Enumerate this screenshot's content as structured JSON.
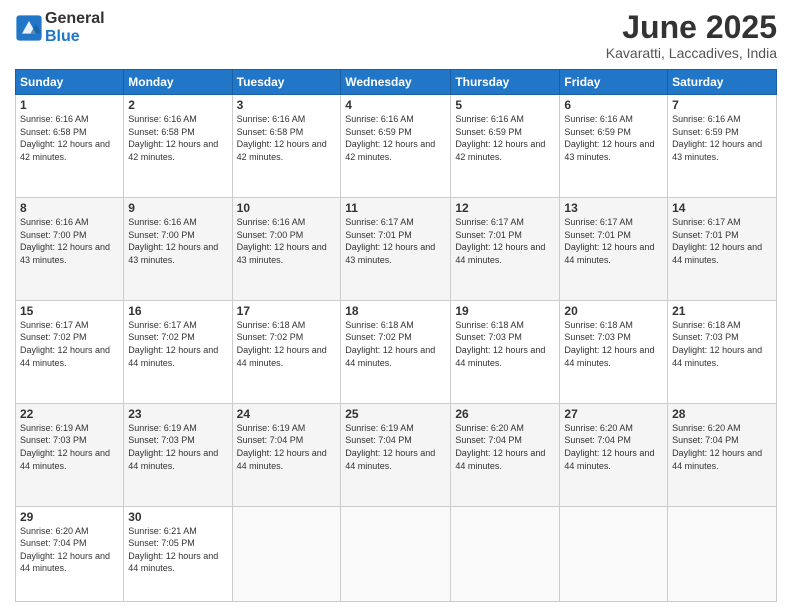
{
  "logo": {
    "general": "General",
    "blue": "Blue"
  },
  "title": "June 2025",
  "location": "Kavaratti, Laccadives, India",
  "days_header": [
    "Sunday",
    "Monday",
    "Tuesday",
    "Wednesday",
    "Thursday",
    "Friday",
    "Saturday"
  ],
  "weeks": [
    [
      {
        "num": "1",
        "sunrise": "6:16 AM",
        "sunset": "6:58 PM",
        "daylight": "12 hours and 42 minutes."
      },
      {
        "num": "2",
        "sunrise": "6:16 AM",
        "sunset": "6:58 PM",
        "daylight": "12 hours and 42 minutes."
      },
      {
        "num": "3",
        "sunrise": "6:16 AM",
        "sunset": "6:58 PM",
        "daylight": "12 hours and 42 minutes."
      },
      {
        "num": "4",
        "sunrise": "6:16 AM",
        "sunset": "6:59 PM",
        "daylight": "12 hours and 42 minutes."
      },
      {
        "num": "5",
        "sunrise": "6:16 AM",
        "sunset": "6:59 PM",
        "daylight": "12 hours and 42 minutes."
      },
      {
        "num": "6",
        "sunrise": "6:16 AM",
        "sunset": "6:59 PM",
        "daylight": "12 hours and 43 minutes."
      },
      {
        "num": "7",
        "sunrise": "6:16 AM",
        "sunset": "6:59 PM",
        "daylight": "12 hours and 43 minutes."
      }
    ],
    [
      {
        "num": "8",
        "sunrise": "6:16 AM",
        "sunset": "7:00 PM",
        "daylight": "12 hours and 43 minutes."
      },
      {
        "num": "9",
        "sunrise": "6:16 AM",
        "sunset": "7:00 PM",
        "daylight": "12 hours and 43 minutes."
      },
      {
        "num": "10",
        "sunrise": "6:16 AM",
        "sunset": "7:00 PM",
        "daylight": "12 hours and 43 minutes."
      },
      {
        "num": "11",
        "sunrise": "6:17 AM",
        "sunset": "7:01 PM",
        "daylight": "12 hours and 43 minutes."
      },
      {
        "num": "12",
        "sunrise": "6:17 AM",
        "sunset": "7:01 PM",
        "daylight": "12 hours and 44 minutes."
      },
      {
        "num": "13",
        "sunrise": "6:17 AM",
        "sunset": "7:01 PM",
        "daylight": "12 hours and 44 minutes."
      },
      {
        "num": "14",
        "sunrise": "6:17 AM",
        "sunset": "7:01 PM",
        "daylight": "12 hours and 44 minutes."
      }
    ],
    [
      {
        "num": "15",
        "sunrise": "6:17 AM",
        "sunset": "7:02 PM",
        "daylight": "12 hours and 44 minutes."
      },
      {
        "num": "16",
        "sunrise": "6:17 AM",
        "sunset": "7:02 PM",
        "daylight": "12 hours and 44 minutes."
      },
      {
        "num": "17",
        "sunrise": "6:18 AM",
        "sunset": "7:02 PM",
        "daylight": "12 hours and 44 minutes."
      },
      {
        "num": "18",
        "sunrise": "6:18 AM",
        "sunset": "7:02 PM",
        "daylight": "12 hours and 44 minutes."
      },
      {
        "num": "19",
        "sunrise": "6:18 AM",
        "sunset": "7:03 PM",
        "daylight": "12 hours and 44 minutes."
      },
      {
        "num": "20",
        "sunrise": "6:18 AM",
        "sunset": "7:03 PM",
        "daylight": "12 hours and 44 minutes."
      },
      {
        "num": "21",
        "sunrise": "6:18 AM",
        "sunset": "7:03 PM",
        "daylight": "12 hours and 44 minutes."
      }
    ],
    [
      {
        "num": "22",
        "sunrise": "6:19 AM",
        "sunset": "7:03 PM",
        "daylight": "12 hours and 44 minutes."
      },
      {
        "num": "23",
        "sunrise": "6:19 AM",
        "sunset": "7:03 PM",
        "daylight": "12 hours and 44 minutes."
      },
      {
        "num": "24",
        "sunrise": "6:19 AM",
        "sunset": "7:04 PM",
        "daylight": "12 hours and 44 minutes."
      },
      {
        "num": "25",
        "sunrise": "6:19 AM",
        "sunset": "7:04 PM",
        "daylight": "12 hours and 44 minutes."
      },
      {
        "num": "26",
        "sunrise": "6:20 AM",
        "sunset": "7:04 PM",
        "daylight": "12 hours and 44 minutes."
      },
      {
        "num": "27",
        "sunrise": "6:20 AM",
        "sunset": "7:04 PM",
        "daylight": "12 hours and 44 minutes."
      },
      {
        "num": "28",
        "sunrise": "6:20 AM",
        "sunset": "7:04 PM",
        "daylight": "12 hours and 44 minutes."
      }
    ],
    [
      {
        "num": "29",
        "sunrise": "6:20 AM",
        "sunset": "7:04 PM",
        "daylight": "12 hours and 44 minutes."
      },
      {
        "num": "30",
        "sunrise": "6:21 AM",
        "sunset": "7:05 PM",
        "daylight": "12 hours and 44 minutes."
      },
      null,
      null,
      null,
      null,
      null
    ]
  ]
}
